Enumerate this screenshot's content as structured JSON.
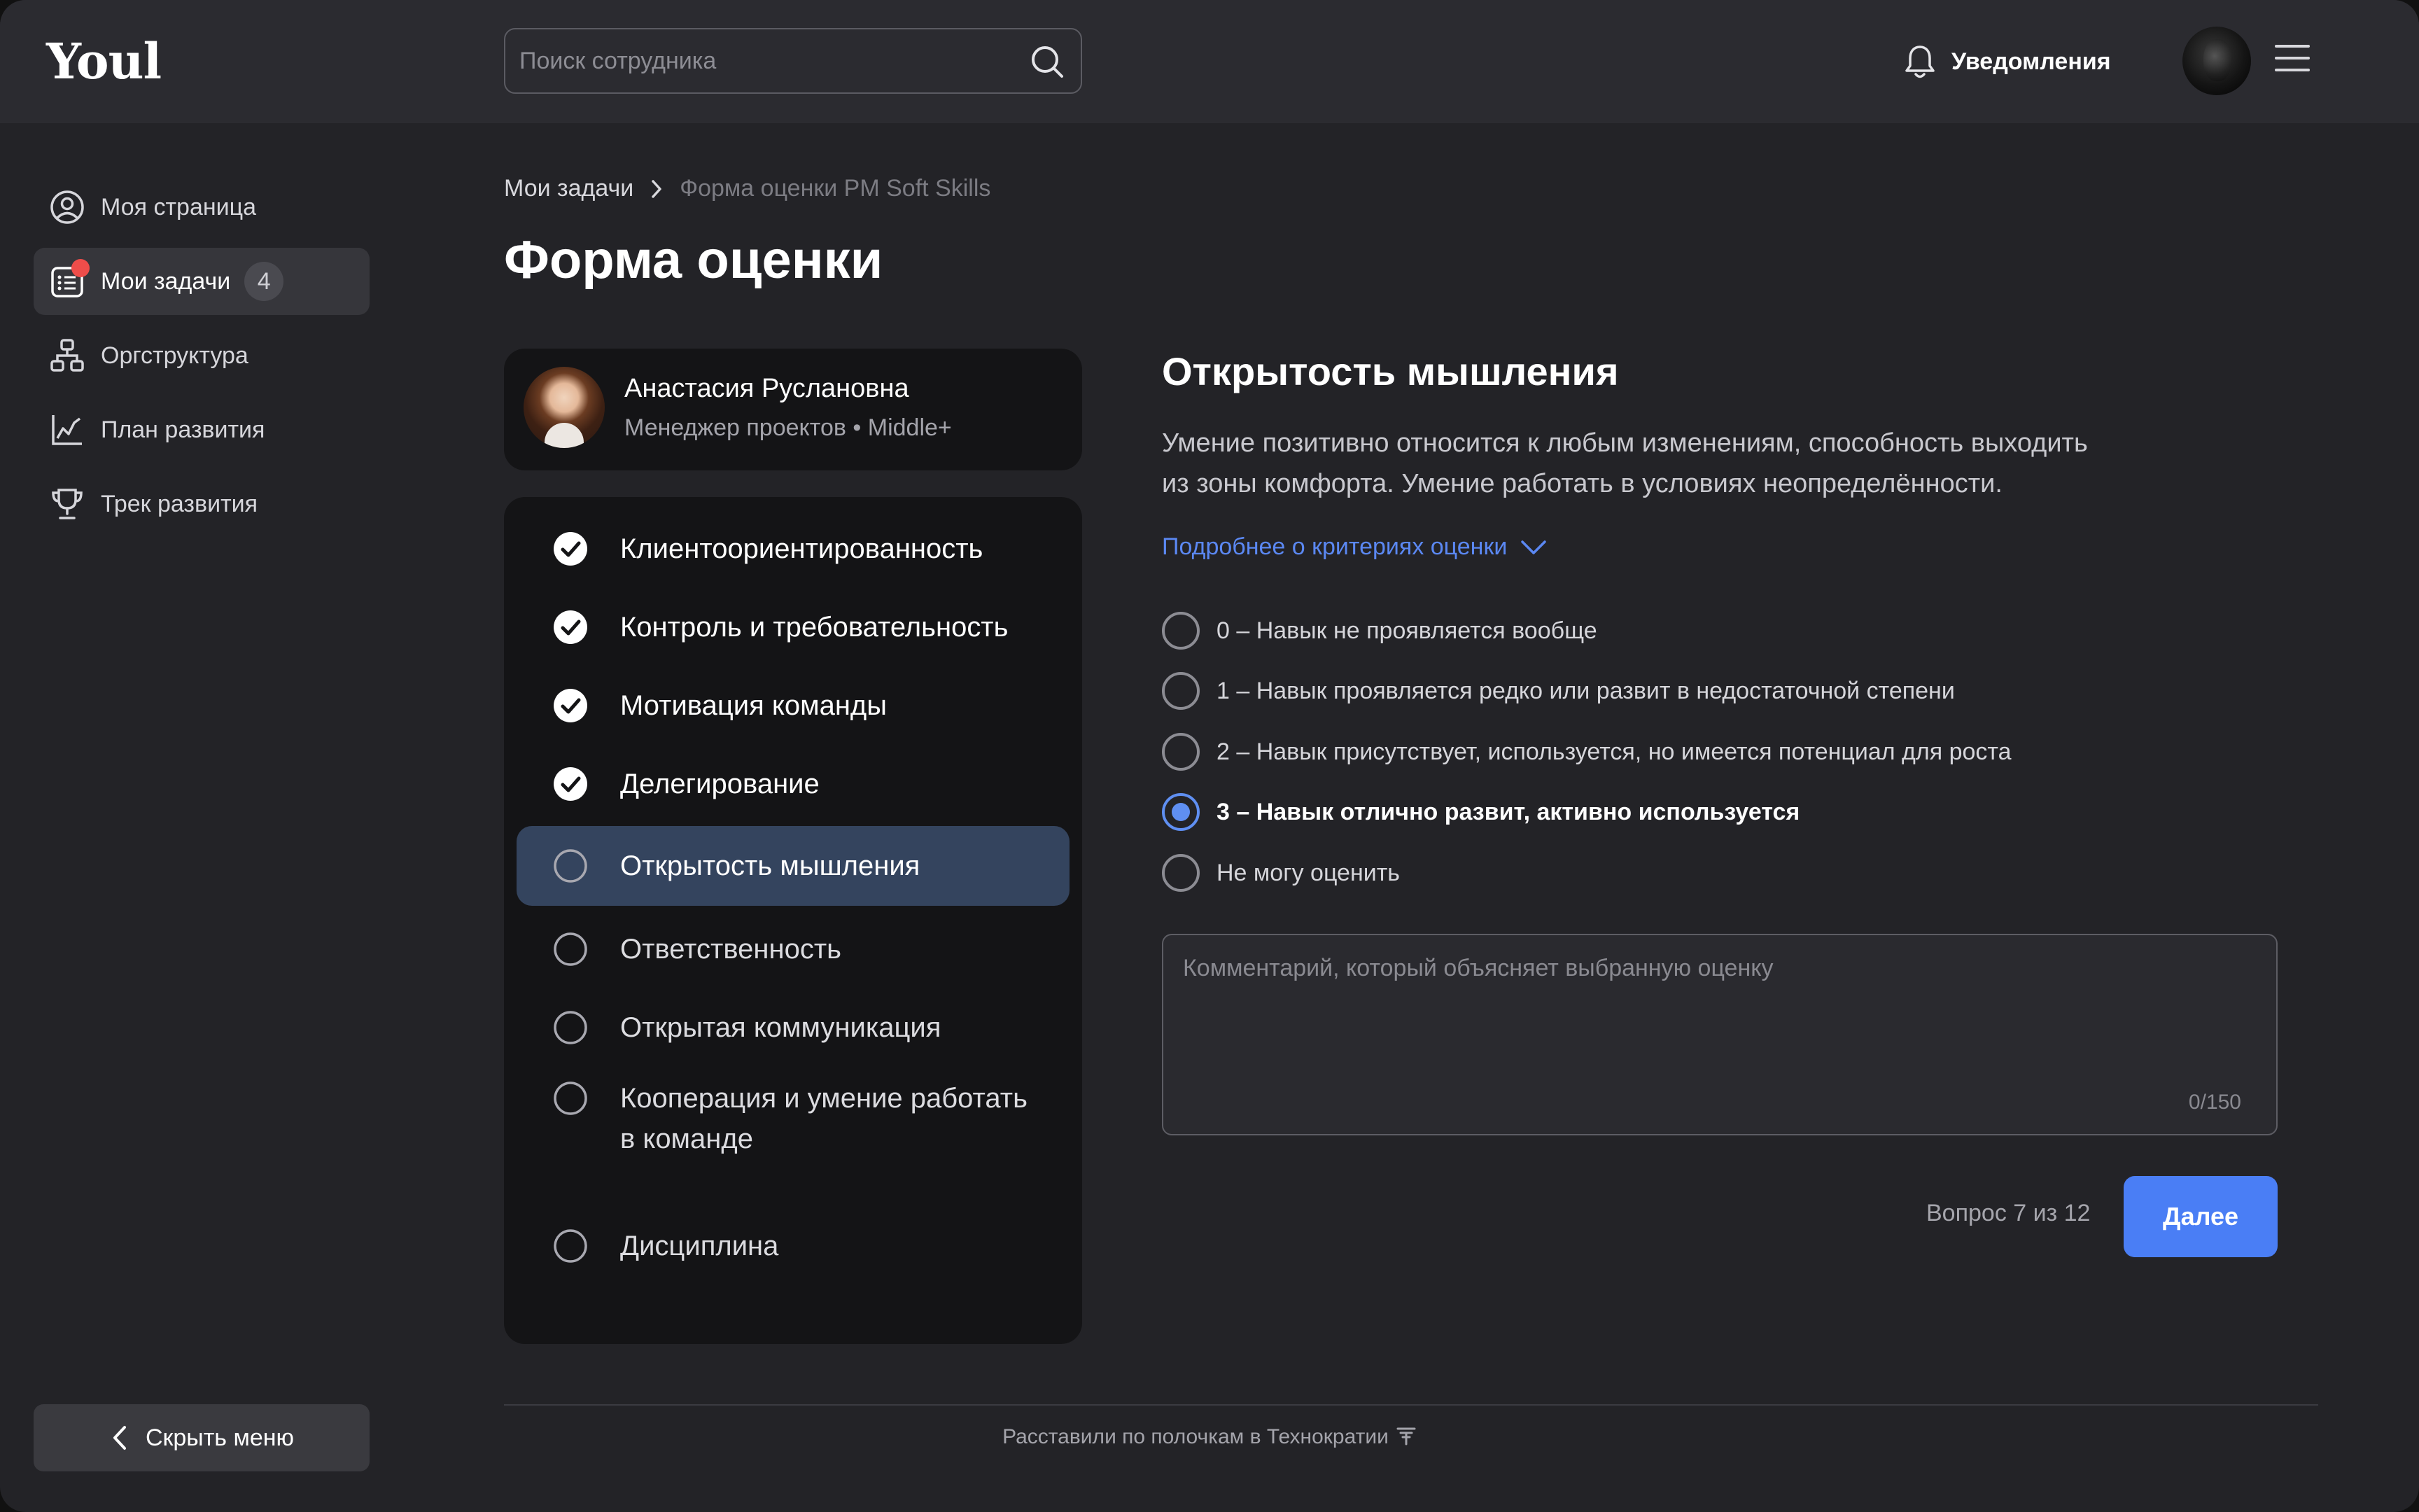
{
  "header": {
    "logo": "Youl",
    "search_placeholder": "Поиск сотрудника",
    "notifications_label": "Уведомления"
  },
  "sidebar": {
    "items": [
      {
        "label": "Моя страница",
        "icon": "user-circle-icon"
      },
      {
        "label": "Мои задачи",
        "icon": "tasks-icon",
        "count": "4",
        "active": true
      },
      {
        "label": "Оргструктура",
        "icon": "org-structure-icon"
      },
      {
        "label": "План развития",
        "icon": "chart-icon"
      },
      {
        "label": "Трек развития",
        "icon": "trophy-icon"
      }
    ],
    "hide_menu_label": "Скрыть меню"
  },
  "breadcrumb": {
    "parent": "Мои задачи",
    "current": "Форма оценки PM Soft Skills"
  },
  "page_title": "Форма оценки",
  "employee": {
    "name": "Анастасия Руслановна",
    "role": "Менеджер проектов • Middle+"
  },
  "criteria": [
    {
      "label": "Клиентоориентированность",
      "state": "done"
    },
    {
      "label": "Контроль и требовательность",
      "state": "done"
    },
    {
      "label": "Мотивация команды",
      "state": "done"
    },
    {
      "label": "Делегирование",
      "state": "done"
    },
    {
      "label": "Открытость мышления",
      "state": "active"
    },
    {
      "label": "Ответственность",
      "state": "pending"
    },
    {
      "label": "Открытая коммуникация",
      "state": "pending"
    },
    {
      "label_line1": "Кооперация и умение работать",
      "label_line2": "в команде",
      "state": "pending"
    },
    {
      "label": "Дисциплина",
      "state": "pending"
    }
  ],
  "question": {
    "title": "Открытость мышления",
    "description_line1": "Умение позитивно относится к любым изменениям, способность выходить",
    "description_line2": "из зоны комфорта. Умение работать в условиях неопределённости.",
    "criteria_link": "Подробнее о критериях оценки",
    "options": [
      "0 – Навык не проявляется вообще",
      "1 – Навык проявляется редко или развит в недостаточной степени",
      "2 – Навык присутствует, используется, но имеется потенциал для роста",
      "3 – Навык отлично развит, активно используется",
      "Не могу оценить"
    ],
    "selected_option": "3 – Навык отлично развит, активно используется",
    "comment_placeholder": "Комментарий, который объясняет выбранную оценку",
    "comment_value": "",
    "char_counter": "0/150",
    "progress": "Вопрос 7 из 12",
    "next_label": "Далее"
  },
  "footer": {
    "text": "Расставили по полочкам в Технократии"
  },
  "colors": {
    "accent": "#4a7ef5",
    "selected_radio": "#5f8ff2",
    "active_criterion_bg": "#34445e",
    "badge_dot": "#ee4d4a",
    "link": "#5b88f3"
  }
}
